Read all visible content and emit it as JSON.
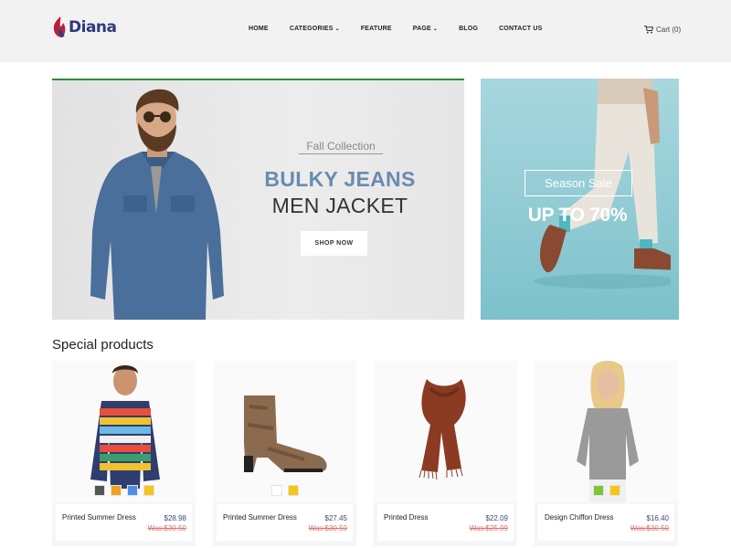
{
  "brand": {
    "name": "Diana",
    "logo_icon": "flame-logo-icon"
  },
  "nav": {
    "items": [
      {
        "label": "HOME",
        "has_dropdown": false
      },
      {
        "label": "CATEGORIES",
        "has_dropdown": true
      },
      {
        "label": "FEATURE",
        "has_dropdown": false
      },
      {
        "label": "PAGE",
        "has_dropdown": true
      },
      {
        "label": "BLOG",
        "has_dropdown": false
      },
      {
        "label": "CONTACT US",
        "has_dropdown": false
      }
    ],
    "caret": "⌄"
  },
  "cart": {
    "label": "Cart (0)",
    "icon": "cart-icon"
  },
  "hero": {
    "subtitle": "Fall Collection",
    "title_line1": "BULKY JEANS",
    "title_line2": "MEN JACKET",
    "button_label": "SHOP NOW",
    "accent_color": "#6b8bb0",
    "top_bar_color": "#2f8f2f"
  },
  "side_banner": {
    "label": "Season Sale",
    "headline": "UP TO 70%"
  },
  "section": {
    "title": "Special products"
  },
  "products": [
    {
      "name": "Printed Summer Dress",
      "price": "$28.98",
      "was": "Was:$30.50",
      "swatches": [
        "#555555",
        "#f2a31b",
        "#4f8fe6",
        "#f5c518"
      ]
    },
    {
      "name": "Printed Summer Dress",
      "price": "$27.45",
      "was": "Was:$30.50",
      "swatches": [
        "#ffffff",
        "#f5c518"
      ]
    },
    {
      "name": "Printed Dress",
      "price": "$22.09",
      "was": "Was:$25.99",
      "swatches": []
    },
    {
      "name": "Design Chiffon Dress",
      "price": "$16.40",
      "was": "Was:$30.50",
      "swatches": [
        "#7cc63a",
        "#f5c518"
      ]
    }
  ]
}
